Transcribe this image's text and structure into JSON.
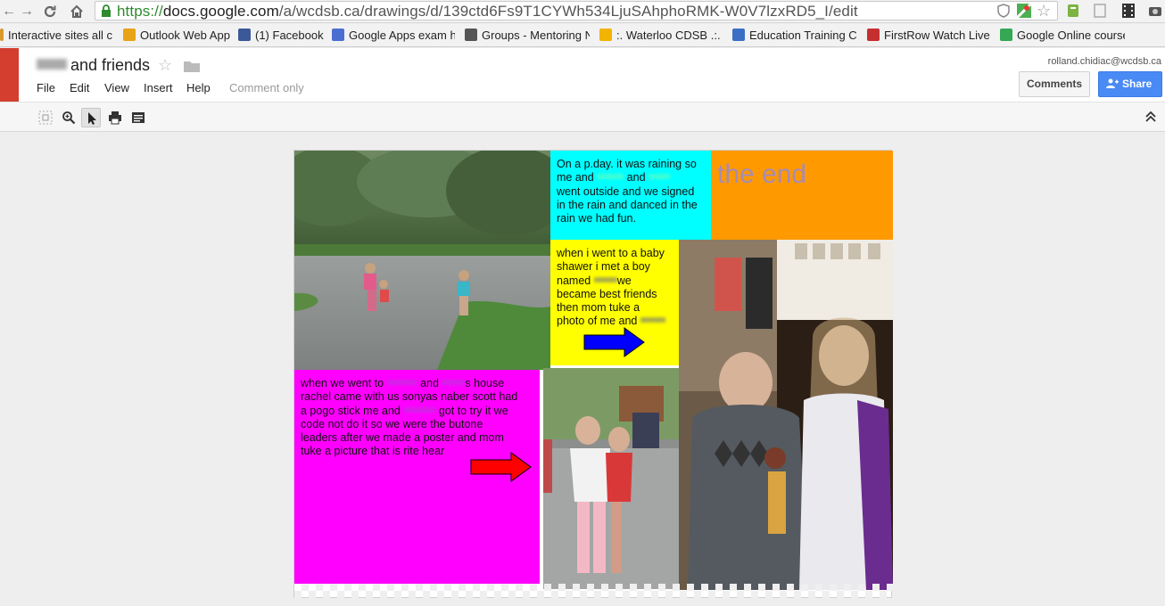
{
  "browser": {
    "url_scheme": "https://",
    "url_host": "docs.google.com",
    "url_path": "/a/wcdsb.ca/drawings/d/139ctd6Fs9T1CYWh534LjuSAhphoRMK-W0V7lzxRD5_I/edit",
    "bookmarks": [
      {
        "label": "Interactive sites all c",
        "color": "#d99a2b"
      },
      {
        "label": "Outlook Web App",
        "color": "#e8a317"
      },
      {
        "label": "(1) Facebook",
        "color": "#3b5998"
      },
      {
        "label": "Google Apps exam h",
        "color": "#4a6fd1"
      },
      {
        "label": "Groups - Mentoring N",
        "color": "#555555"
      },
      {
        "label": ":. Waterloo CDSB .:. C",
        "color": "#f2b400"
      },
      {
        "label": "Education Training Co",
        "color": "#3b6fc4"
      },
      {
        "label": "FirstRow Watch Live N",
        "color": "#c62f2f"
      },
      {
        "label": "Google Online course",
        "color": "#34a853"
      }
    ]
  },
  "doc": {
    "title": "and friends",
    "menus": [
      "File",
      "Edit",
      "View",
      "Insert",
      "Help"
    ],
    "comment_only": "Comment only",
    "user_email": "rolland.chidiac@wcdsb.ca",
    "comments_label": "Comments",
    "share_label": "Share"
  },
  "canvas": {
    "text1_line1": "On a p.day. it was raining so",
    "text1_line2a": "me and",
    "text1_line2b": "and",
    "text1_line3": "went outside and we signed",
    "text1_line4": "in the rain and danced in the",
    "text1_line5": "rain we had fun.",
    "the_end": "the end",
    "text2_line1": "when i went to a baby",
    "text2_line2": "shawer i met a boy",
    "text2_line3a": "named",
    "text2_line3b": "we",
    "text2_line4": "became best friends",
    "text2_line5": "then mom tuke a",
    "text2_line6": "photo of me and",
    "text3_line1a": "when we went to",
    "text3_line1b": "and",
    "text3_line1c": "s house",
    "text3_line2": "rachel came with us sonyas naber scott  had",
    "text3_line3a": "a pogo stick me and",
    "text3_line3b": "got to try it we",
    "text3_line4": "code not do it so we were the butone",
    "text3_line5": "leaders  after we made a poster and mom",
    "text3_line6": "tuke  a picture that is rite hear"
  },
  "colors": {
    "cyan": "#00ffff",
    "orange": "#ff9900",
    "yellow": "#ffff00",
    "magenta": "#ff00ff",
    "blue_arrow": "#0000ff",
    "red_arrow": "#ff0000",
    "end_text": "#a78bb6"
  }
}
